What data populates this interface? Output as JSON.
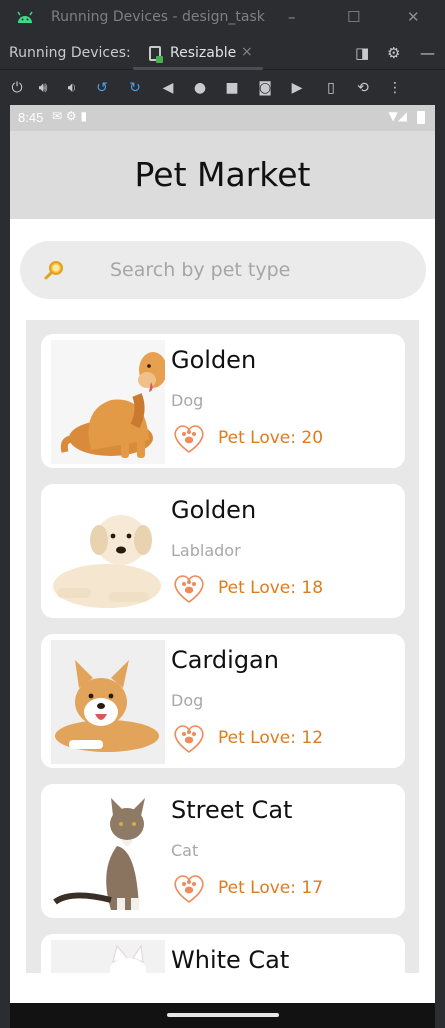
{
  "ide": {
    "window_title": "Running Devices - design_task",
    "panel_label": "Running Devices:",
    "tab_label": "Resizable",
    "tab_close": "×",
    "controls": {
      "minimize": "–",
      "maximize": "☐",
      "close": "✕"
    }
  },
  "device": {
    "status": {
      "time": "8:45"
    },
    "app_title": "Pet Market",
    "search": {
      "placeholder": "Search by pet type",
      "value": ""
    },
    "pets": [
      {
        "name": "Golden",
        "type": "Dog",
        "love": "Pet Love: 20",
        "photo": "golden-retriever"
      },
      {
        "name": "Golden",
        "type": "Lablador",
        "love": "Pet Love: 18",
        "photo": "labrador-puppy"
      },
      {
        "name": "Cardigan",
        "type": "Dog",
        "love": "Pet Love: 12",
        "photo": "corgi"
      },
      {
        "name": "Street Cat",
        "type": "Cat",
        "love": "Pet Love: 17",
        "photo": "tabby-cat"
      },
      {
        "name": "White Cat",
        "type": "",
        "love": "",
        "photo": "white-cat"
      }
    ]
  },
  "colors": {
    "accent": "#e07b1c",
    "appbar": "#dcdcdc",
    "list_bg": "#e8e8e8",
    "ide_bg": "#2b2d30"
  }
}
